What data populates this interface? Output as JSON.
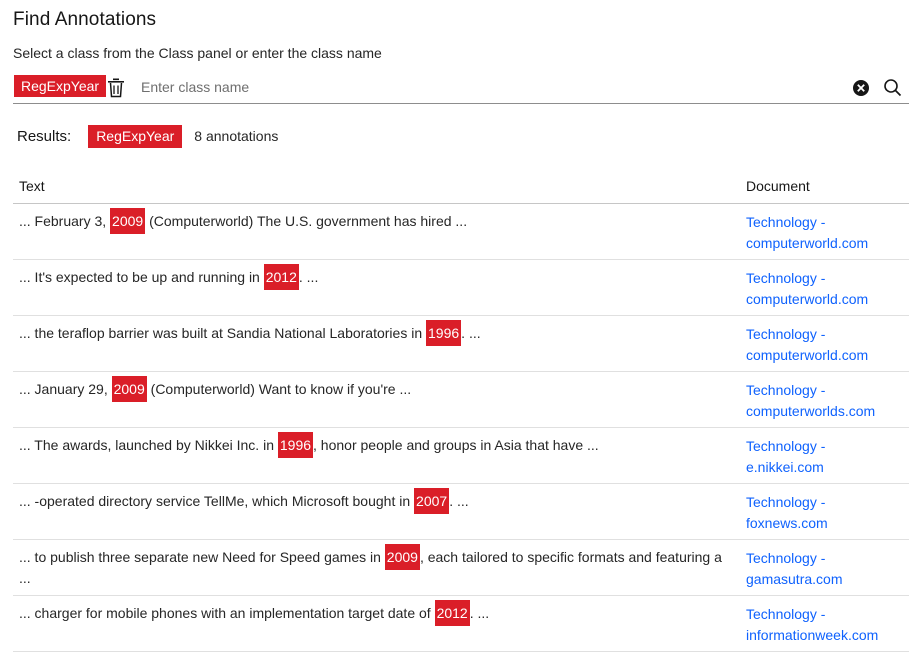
{
  "title": "Find Annotations",
  "subtitle": "Select a class from the Class panel or enter the class name",
  "search": {
    "tag": "RegExpYear",
    "placeholder": "Enter class name",
    "value": ""
  },
  "results": {
    "label": "Results:",
    "tag": "RegExpYear",
    "count": "8 annotations"
  },
  "table": {
    "headers": {
      "text": "Text",
      "document": "Document"
    },
    "rows": [
      {
        "before": "... February 3, ",
        "match": "2009",
        "after": " (Computerworld) The U.S. government has hired ...",
        "doc1": "Technology -",
        "doc2": "computerworld.com"
      },
      {
        "before": "... It's expected to be up and running in ",
        "match": "2012",
        "after": ". ...",
        "doc1": "Technology -",
        "doc2": "computerworld.com"
      },
      {
        "before": "... the teraflop barrier was built at Sandia National Laboratories in ",
        "match": "1996",
        "after": ". ...",
        "doc1": "Technology -",
        "doc2": "computerworld.com"
      },
      {
        "before": "... January 29, ",
        "match": "2009",
        "after": " (Computerworld) Want to know if you're ...",
        "doc1": "Technology -",
        "doc2": "computerworlds.com"
      },
      {
        "before": "... The awards, launched by Nikkei Inc. in ",
        "match": "1996",
        "after": ", honor people and groups in Asia that have ...",
        "doc1": "Technology -",
        "doc2": "e.nikkei.com"
      },
      {
        "before": "... -operated directory service TellMe, which Microsoft bought in ",
        "match": "2007",
        "after": ". ...",
        "doc1": "Technology -",
        "doc2": "foxnews.com"
      },
      {
        "before": "... to publish three separate new Need for Speed games in ",
        "match": "2009",
        "after": ", each tailored to specific formats and featuring a ...",
        "doc1": "Technology -",
        "doc2": "gamasutra.com"
      },
      {
        "before": "... charger for mobile phones with an implementation target date of ",
        "match": "2012",
        "after": ". ...",
        "doc1": "Technology -",
        "doc2": "informationweek.com"
      }
    ]
  },
  "colors": {
    "accent": "#da1e28",
    "link": "#0f62fe"
  },
  "icons": {
    "delete": "trash-icon",
    "clear": "close-filled-icon",
    "search": "search-icon"
  }
}
